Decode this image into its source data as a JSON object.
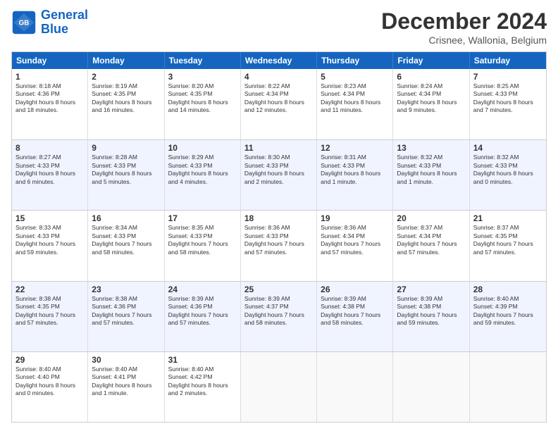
{
  "logo": {
    "line1": "General",
    "line2": "Blue"
  },
  "title": "December 2024",
  "location": "Crisnee, Wallonia, Belgium",
  "days_of_week": [
    "Sunday",
    "Monday",
    "Tuesday",
    "Wednesday",
    "Thursday",
    "Friday",
    "Saturday"
  ],
  "weeks": [
    [
      {
        "day": "1",
        "sunrise": "8:18 AM",
        "sunset": "4:36 PM",
        "daylight": "8 hours and 18 minutes."
      },
      {
        "day": "2",
        "sunrise": "8:19 AM",
        "sunset": "4:35 PM",
        "daylight": "8 hours and 16 minutes."
      },
      {
        "day": "3",
        "sunrise": "8:20 AM",
        "sunset": "4:35 PM",
        "daylight": "8 hours and 14 minutes."
      },
      {
        "day": "4",
        "sunrise": "8:22 AM",
        "sunset": "4:34 PM",
        "daylight": "8 hours and 12 minutes."
      },
      {
        "day": "5",
        "sunrise": "8:23 AM",
        "sunset": "4:34 PM",
        "daylight": "8 hours and 11 minutes."
      },
      {
        "day": "6",
        "sunrise": "8:24 AM",
        "sunset": "4:34 PM",
        "daylight": "8 hours and 9 minutes."
      },
      {
        "day": "7",
        "sunrise": "8:25 AM",
        "sunset": "4:33 PM",
        "daylight": "8 hours and 7 minutes."
      }
    ],
    [
      {
        "day": "8",
        "sunrise": "8:27 AM",
        "sunset": "4:33 PM",
        "daylight": "8 hours and 6 minutes."
      },
      {
        "day": "9",
        "sunrise": "8:28 AM",
        "sunset": "4:33 PM",
        "daylight": "8 hours and 5 minutes."
      },
      {
        "day": "10",
        "sunrise": "8:29 AM",
        "sunset": "4:33 PM",
        "daylight": "8 hours and 4 minutes."
      },
      {
        "day": "11",
        "sunrise": "8:30 AM",
        "sunset": "4:33 PM",
        "daylight": "8 hours and 2 minutes."
      },
      {
        "day": "12",
        "sunrise": "8:31 AM",
        "sunset": "4:33 PM",
        "daylight": "8 hours and 1 minute."
      },
      {
        "day": "13",
        "sunrise": "8:32 AM",
        "sunset": "4:33 PM",
        "daylight": "8 hours and 1 minute."
      },
      {
        "day": "14",
        "sunrise": "8:32 AM",
        "sunset": "4:33 PM",
        "daylight": "8 hours and 0 minutes."
      }
    ],
    [
      {
        "day": "15",
        "sunrise": "8:33 AM",
        "sunset": "4:33 PM",
        "daylight": "7 hours and 59 minutes."
      },
      {
        "day": "16",
        "sunrise": "8:34 AM",
        "sunset": "4:33 PM",
        "daylight": "7 hours and 58 minutes."
      },
      {
        "day": "17",
        "sunrise": "8:35 AM",
        "sunset": "4:33 PM",
        "daylight": "7 hours and 58 minutes."
      },
      {
        "day": "18",
        "sunrise": "8:36 AM",
        "sunset": "4:33 PM",
        "daylight": "7 hours and 57 minutes."
      },
      {
        "day": "19",
        "sunrise": "8:36 AM",
        "sunset": "4:34 PM",
        "daylight": "7 hours and 57 minutes."
      },
      {
        "day": "20",
        "sunrise": "8:37 AM",
        "sunset": "4:34 PM",
        "daylight": "7 hours and 57 minutes."
      },
      {
        "day": "21",
        "sunrise": "8:37 AM",
        "sunset": "4:35 PM",
        "daylight": "7 hours and 57 minutes."
      }
    ],
    [
      {
        "day": "22",
        "sunrise": "8:38 AM",
        "sunset": "4:35 PM",
        "daylight": "7 hours and 57 minutes."
      },
      {
        "day": "23",
        "sunrise": "8:38 AM",
        "sunset": "4:36 PM",
        "daylight": "7 hours and 57 minutes."
      },
      {
        "day": "24",
        "sunrise": "8:39 AM",
        "sunset": "4:36 PM",
        "daylight": "7 hours and 57 minutes."
      },
      {
        "day": "25",
        "sunrise": "8:39 AM",
        "sunset": "4:37 PM",
        "daylight": "7 hours and 58 minutes."
      },
      {
        "day": "26",
        "sunrise": "8:39 AM",
        "sunset": "4:38 PM",
        "daylight": "7 hours and 58 minutes."
      },
      {
        "day": "27",
        "sunrise": "8:39 AM",
        "sunset": "4:38 PM",
        "daylight": "7 hours and 59 minutes."
      },
      {
        "day": "28",
        "sunrise": "8:40 AM",
        "sunset": "4:39 PM",
        "daylight": "7 hours and 59 minutes."
      }
    ],
    [
      {
        "day": "29",
        "sunrise": "8:40 AM",
        "sunset": "4:40 PM",
        "daylight": "8 hours and 0 minutes."
      },
      {
        "day": "30",
        "sunrise": "8:40 AM",
        "sunset": "4:41 PM",
        "daylight": "8 hours and 1 minute."
      },
      {
        "day": "31",
        "sunrise": "8:40 AM",
        "sunset": "4:42 PM",
        "daylight": "8 hours and 2 minutes."
      },
      null,
      null,
      null,
      null
    ]
  ]
}
